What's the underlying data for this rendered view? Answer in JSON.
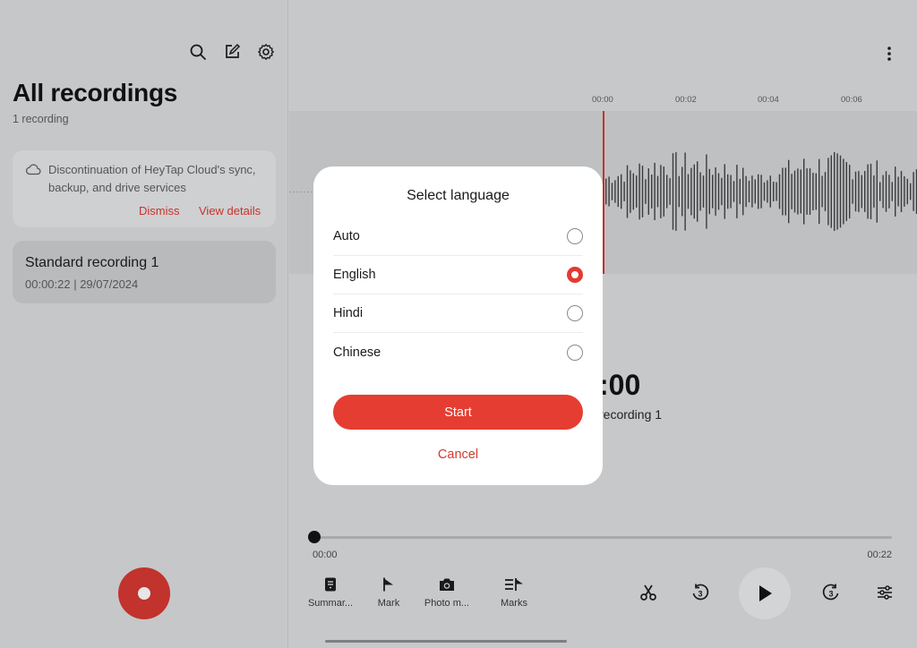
{
  "sidebar": {
    "title": "All recordings",
    "count": "1 recording",
    "notice": {
      "text": "Discontinuation of HeyTap Cloud's sync, backup, and drive services",
      "dismiss": "Dismiss",
      "view_details": "View details"
    },
    "recordings": [
      {
        "name": "Standard recording 1",
        "meta": "00:00:22  |  29/07/2024"
      }
    ]
  },
  "player": {
    "ticks": [
      "00:00",
      "00:02",
      "00:04",
      "00:06"
    ],
    "big_time_partial": ":00",
    "big_name_partial": "recording 1",
    "time_start": "00:00",
    "time_end": "00:22",
    "progress": 0,
    "tools": [
      {
        "label": "Summar...",
        "icon": "summary-icon"
      },
      {
        "label": "Mark",
        "icon": "mark-flag-icon"
      },
      {
        "label": "Photo m...",
        "icon": "camera-icon"
      },
      {
        "label": "Marks",
        "icon": "marks-list-icon"
      }
    ]
  },
  "dialog": {
    "title": "Select language",
    "options": [
      {
        "label": "Auto",
        "selected": false
      },
      {
        "label": "English",
        "selected": true
      },
      {
        "label": "Hindi",
        "selected": false
      },
      {
        "label": "Chinese",
        "selected": false
      }
    ],
    "start_label": "Start",
    "cancel_label": "Cancel"
  },
  "colors": {
    "accent": "#e53d31",
    "record": "#c1332c"
  }
}
